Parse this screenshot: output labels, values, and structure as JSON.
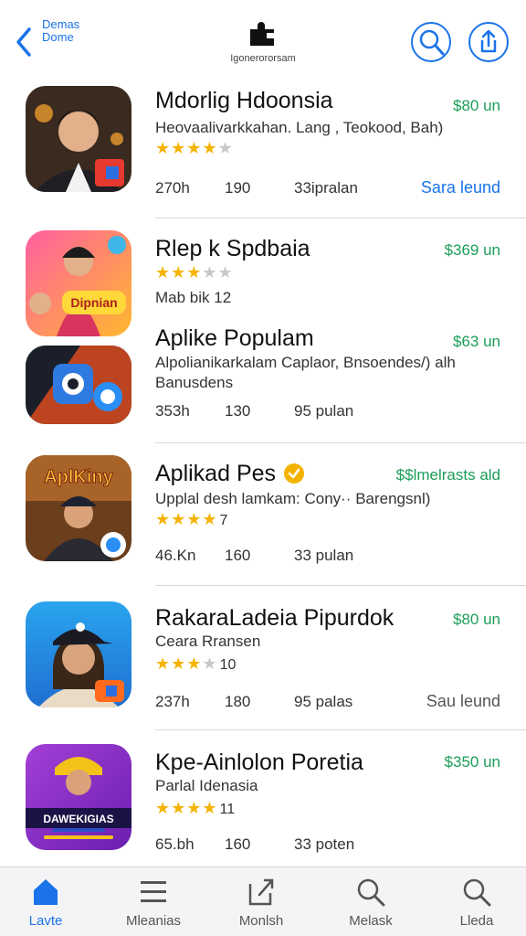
{
  "header": {
    "back_label_line1": "Demas",
    "back_label_line2": "Dome",
    "center_label": "Igonerororsam"
  },
  "apps": [
    {
      "title": "Mdorlig Hdoonsia",
      "price": "$80 un",
      "subtitle": "Heovaalivarkkahan. Lang , Teokood, Bah)",
      "rating": 4,
      "stat1": "270h",
      "stat2": "190",
      "stat3": "33ipralan",
      "action": "Sara leund",
      "icon": "boy-portrait-icon"
    },
    {
      "title": "Rlep k Spdbaia",
      "price": "$369 un",
      "subtitle": "Mab bik 12",
      "rating": 3,
      "icon": "girl-cartoon-icon",
      "icon_text": "Dipnian"
    },
    {
      "title": "Aplike Populam",
      "price": "$63 un",
      "subtitle": "Alpolianikarkalam Caplaor, Bnsoendes/) alh Banusdens",
      "stat1": "353h",
      "stat2": "130",
      "stat3": "95 pulan",
      "icon": "lens-abstract-icon"
    },
    {
      "title": "Aplikad Pes",
      "price": "$$lmelrasts ald",
      "subtitle": "Upplal desh lamkam: Cony·· Barengsnl)",
      "rating": 4,
      "extra": "7",
      "stat1": "46.Kn",
      "stat2": "160",
      "stat3": "33 pulan",
      "icon": "adventurer-icon",
      "icon_text": "AplKiny"
    },
    {
      "title": "RakaraLadeia Pipurdok",
      "price": "$80 un",
      "subtitle": "Ceara Rransen",
      "rating": 3,
      "extra": "10",
      "stat1": "237h",
      "stat2": "180",
      "stat3": "95 palas",
      "action": "Sau leund",
      "icon": "girl-cap-icon"
    },
    {
      "title": "Kpe-Ainlolon Poretia",
      "price": "$350 un",
      "subtitle": "Parlal Idenasia",
      "rating": 4,
      "extra": "11",
      "stat1": "65.bh",
      "stat2": "160",
      "stat3": "33 poten",
      "icon": "dancer-icon",
      "icon_text": "DAWEKIGIAS"
    }
  ],
  "tabbar": {
    "items": [
      {
        "label": "Lavte",
        "icon": "home-icon",
        "active": true
      },
      {
        "label": "Mleanias",
        "icon": "menu-icon"
      },
      {
        "label": "Monlsh",
        "icon": "share-box-icon"
      },
      {
        "label": "Melask",
        "icon": "search-icon"
      },
      {
        "label": "Lleda",
        "icon": "search-icon"
      }
    ]
  },
  "colors": {
    "accent": "#1a73e8",
    "price": "#1b9e57",
    "star": "#f5b301"
  }
}
